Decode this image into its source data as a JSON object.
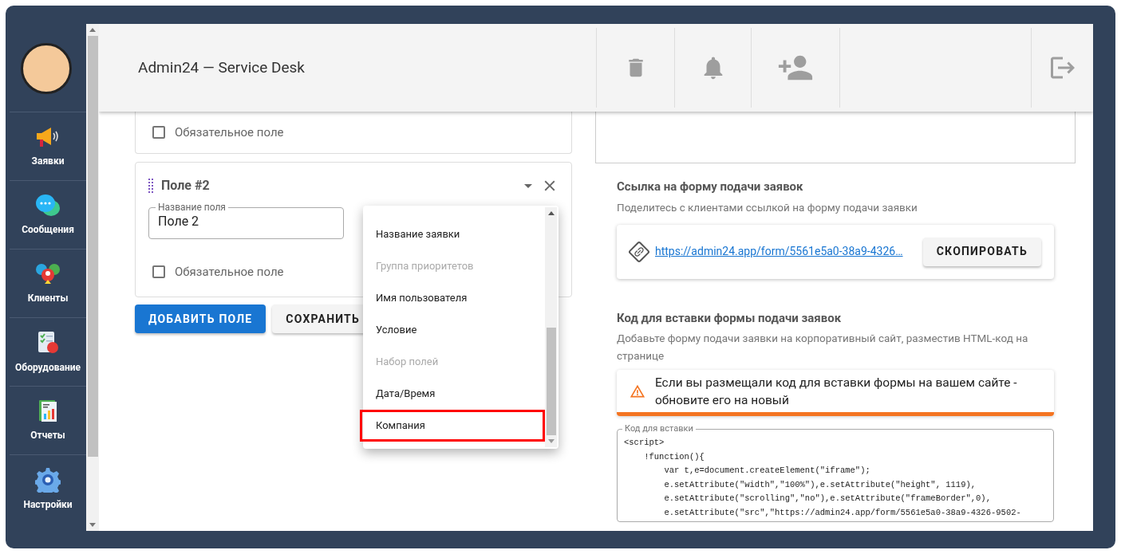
{
  "app_title": "Admin24 — Service Desk",
  "sidebar": {
    "items": [
      {
        "label": "Заявки"
      },
      {
        "label": "Сообщения"
      },
      {
        "label": "Клиенты"
      },
      {
        "label": "Оборудование"
      },
      {
        "label": "Отчеты"
      },
      {
        "label": "Настройки"
      }
    ]
  },
  "fields": [
    {
      "kind": "partial",
      "required_label": "Обязательное поле",
      "required": false
    },
    {
      "kind": "full",
      "title": "Поле #2",
      "name_label": "Название поля",
      "name_value": "Поле 2",
      "required_label": "Обязательное поле",
      "required": false
    }
  ],
  "actions": [
    {
      "label": "ДОБАВИТЬ ПОЛЕ",
      "kind": "primary"
    },
    {
      "label": "СОХРАНИТЬ",
      "kind": "secondary"
    }
  ],
  "type_menu": {
    "items": [
      {
        "label": "Название заявки",
        "disabled": false,
        "highlighted": false
      },
      {
        "label": "Группа приоритетов",
        "disabled": true,
        "highlighted": false
      },
      {
        "label": "Имя пользователя",
        "disabled": false,
        "highlighted": false
      },
      {
        "label": "Условие",
        "disabled": false,
        "highlighted": false
      },
      {
        "label": "Набор полей",
        "disabled": true,
        "highlighted": false
      },
      {
        "label": "Дата/Время",
        "disabled": false,
        "highlighted": false
      },
      {
        "label": "Компания",
        "disabled": false,
        "highlighted": true
      }
    ]
  },
  "link_section": {
    "title": "Ссылка на форму подачи заявок",
    "subtitle": "Поделитесь с клиентами ссылкой на форму подачи заявки",
    "url": "https://admin24.app/form/5561e5a0-38a9-4326…",
    "button": "СКОПИРОВАТЬ"
  },
  "embed_section": {
    "title": "Код для вставки формы подачи заявок",
    "description": "Добавьте форму подачи заявки на корпоративный сайт, разместив HTML-код на странице",
    "warning": "Если вы размещали код для вставки формы на вашем сайте - обновите его на новый",
    "code_label": "Код для вставки",
    "code_lines": [
      "<script>",
      "    !function(){",
      "        var t,e=document.createElement(\"iframe\");",
      "        e.setAttribute(\"width\",\"100%\"),e.setAttribute(\"height\", 1119),",
      "        e.setAttribute(\"scrolling\",\"no\"),e.setAttribute(\"frameBorder\",0),",
      "        e.setAttribute(\"src\",\"https://admin24.app/form/5561e5a0-38a9-4326-9502-"
    ]
  }
}
